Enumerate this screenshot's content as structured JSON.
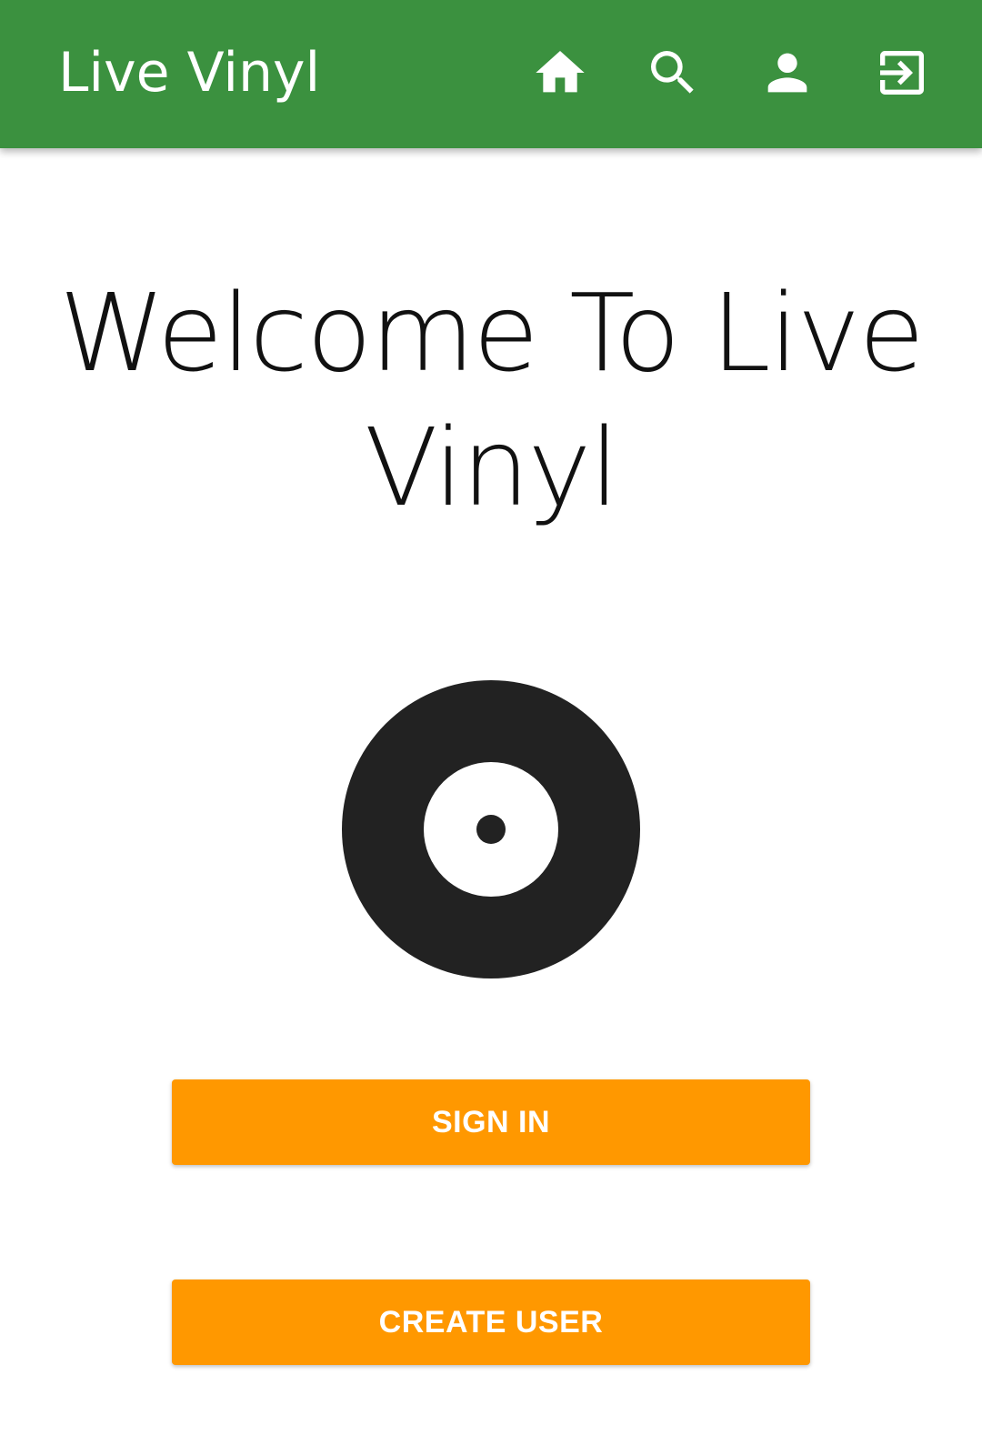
{
  "app_bar": {
    "title": "Live Vinyl",
    "background_color": "#3b913f",
    "icons": [
      "home-icon",
      "search-icon",
      "person-icon",
      "sign-in-icon"
    ]
  },
  "main": {
    "welcome_line1": "Welcome To Live",
    "welcome_line2": "Vinyl",
    "logo_icon": "vinyl-record-icon"
  },
  "buttons": {
    "sign_in_label": "SIGN IN",
    "create_user_label": "CREATE USER",
    "color": "#ff9800"
  }
}
